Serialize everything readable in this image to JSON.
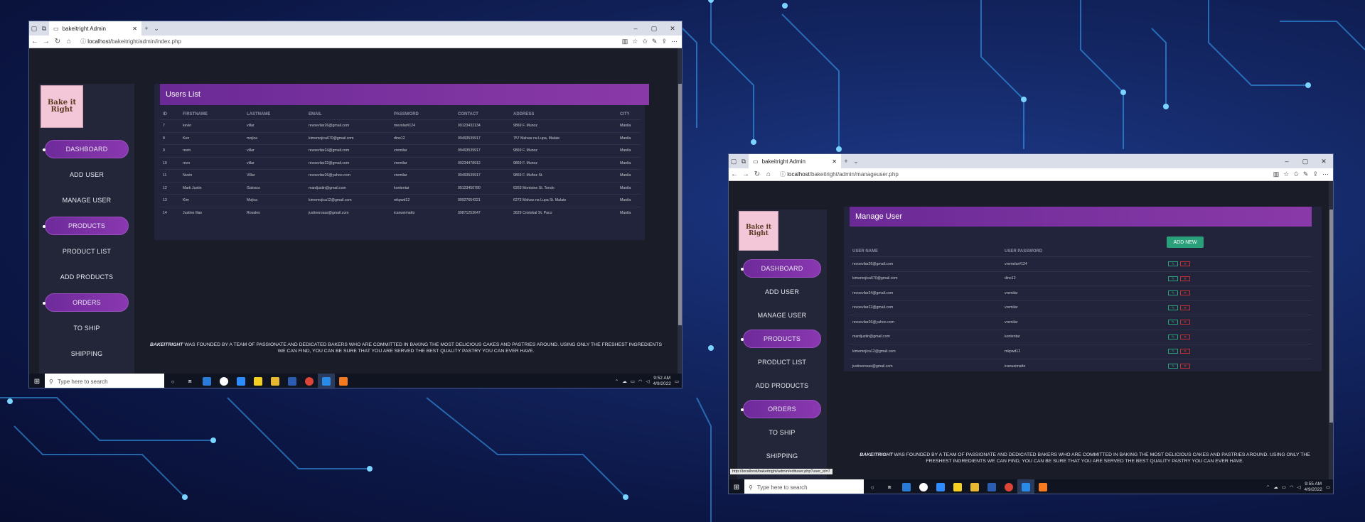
{
  "win1": {
    "tab_title": "bakeitright Admin",
    "url_host": "localhost",
    "url_path": "/bakeitright/admin/index.php",
    "logo_text": [
      "Bake it",
      "Right"
    ],
    "nav": [
      "DASHBOARD",
      "ADD USER",
      "MANAGE USER",
      "PRODUCTS",
      "PRODUCT LIST",
      "ADD PRODUCTS",
      "ORDERS",
      "TO SHIP",
      "SHIPPING"
    ],
    "panel_title": "Users List",
    "columns": [
      "ID",
      "FIRSTNAME",
      "LASTNAME",
      "EMAIL",
      "PASSWORD",
      "CONTACT",
      "ADDRESS",
      "CITY"
    ],
    "rows": [
      [
        "7",
        "kevin",
        "villar",
        "revoevilar26@gmail.com",
        "mevolar#124",
        "09123432134",
        "9869 F. Munoz",
        "Manila"
      ],
      [
        "8",
        "Ken",
        "mojica",
        "kimemojica670@gmail.com",
        "dino12",
        "09493539917",
        "757 Malvas na Lupa, Malate",
        "Manila"
      ],
      [
        "9",
        "revin",
        "villar",
        "revoevilar24@gmail.com",
        "vremilar",
        "09493539917",
        "9869 F. Munoz",
        "Manila"
      ],
      [
        "10",
        "revo",
        "villar",
        "revoevilar22@gmail.com",
        "vremilar",
        "09234478912",
        "9869 F. Munoz",
        "Manila"
      ],
      [
        "11",
        "Nuvin",
        "Villar",
        "revoevilar26@yahoo.com",
        "vremilar",
        "09493539917",
        "9869 F. Muñoz St.",
        "Manila"
      ],
      [
        "12",
        "Mark Justin",
        "Galosco",
        "mardjustin@gmail.com",
        "kontentar",
        "09123450780",
        "6263 Montoine St. Tondo",
        "Manila"
      ],
      [
        "13",
        "Kim",
        "Mojica",
        "kimemojica12@gmail.com",
        "mkpwd12",
        "09927654321",
        "6273 Malvas na Lupa St. Malate",
        "Manila"
      ],
      [
        "14",
        "Justine Ilias",
        "Rosales",
        "justinerosas@gmail.com",
        "icanueimatto",
        "09871253647",
        "3629 Cristobal St. Paco",
        "Manila"
      ]
    ],
    "footer_brand": "BAKEITRIGHT",
    "footer_text": " WAS FOUNDED BY A TEAM OF PASSIONATE AND DEDICATED BAKERS WHO ARE COMMITTED IN BAKING THE MOST DELICIOUS CAKES AND PASTRIES AROUND. USING ONLY THE FRESHEST INGREDIENTS WE CAN FIND, YOU CAN BE SURE THAT YOU ARE SERVED THE BEST QUALITY PASTRY YOU CAN EVER HAVE.",
    "search_placeholder": "Type here to search",
    "time": "9:52 AM",
    "date": "4/9/2022"
  },
  "win2": {
    "tab_title": "bakeitright Admin",
    "url_host": "localhost",
    "url_path": "/bakeitright/admin/manageuser.php",
    "logo_text": [
      "Bake it",
      "Right"
    ],
    "nav": [
      "DASHBOARD",
      "ADD USER",
      "MANAGE USER",
      "PRODUCTS",
      "PRODUCT LIST",
      "ADD PRODUCTS",
      "ORDERS",
      "TO SHIP",
      "SHIPPING"
    ],
    "panel_title": "Manage User",
    "add_new": "ADD NEW",
    "columns": [
      "USER NAME",
      "USER PASSWORD"
    ],
    "rows": [
      [
        "revoevilar26@gmail.com",
        "vremelar#124"
      ],
      [
        "kimemojica670@gmail.com",
        "dino12"
      ],
      [
        "revoevilar24@gmail.com",
        "vremilar"
      ],
      [
        "revoevilar22@gmail.com",
        "vremilar"
      ],
      [
        "revoevilar26@yahoo.com",
        "vremilar"
      ],
      [
        "mardjustin@gmail.com",
        "kontentar"
      ],
      [
        "kimemojica12@gmail.com",
        "mkpwd12"
      ],
      [
        "justinerosas@gmail.com",
        "icanueimatto"
      ]
    ],
    "footer_brand": "BAKEITRIGHT",
    "footer_text": " WAS FOUNDED BY A TEAM OF PASSIONATE AND DEDICATED BAKERS WHO ARE COMMITTED IN BAKING THE MOST DELICIOUS CAKES AND PASTRIES AROUND. USING ONLY THE FRESHEST INGREDIENTS WE CAN FIND, YOU CAN BE SURE THAT YOU ARE SERVED THE BEST QUALITY PASTRY YOU CAN EVER HAVE.",
    "status_url": "http://localhost/bakeitright/admin/edituser.php?user_id=7",
    "search_placeholder": "Type here to search",
    "time": "9:55 AM",
    "date": "4/9/2022"
  }
}
